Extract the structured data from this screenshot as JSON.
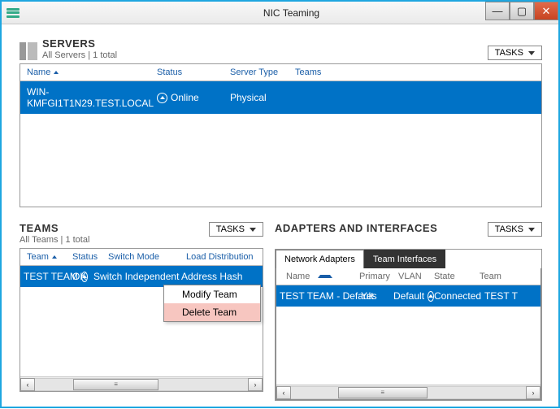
{
  "window": {
    "title": "NIC Teaming",
    "min": "—",
    "max": "▢",
    "close": "✕"
  },
  "servers": {
    "title": "SERVERS",
    "subtitle": "All Servers | 1 total",
    "tasks_label": "TASKS",
    "columns": {
      "name": "Name",
      "status": "Status",
      "type": "Server Type",
      "teams": "Teams"
    },
    "row": {
      "name": "WIN-KMFGI1T1N29.TEST.LOCAL",
      "status": "Online",
      "type": "Physical",
      "teams": ""
    }
  },
  "teams": {
    "title": "TEAMS",
    "subtitle": "All Teams | 1 total",
    "tasks_label": "TASKS",
    "columns": {
      "team": "Team",
      "status": "Status",
      "switch": "Switch Mode",
      "load": "Load Distribution"
    },
    "row": {
      "team": "TEST TEAM",
      "status": "OK",
      "switch": "Switch Independent",
      "load": "Address Hash"
    },
    "context_menu": {
      "modify": "Modify Team",
      "delete": "Delete Team"
    }
  },
  "adapters": {
    "title": "ADAPTERS AND INTERFACES",
    "tasks_label": "TASKS",
    "tabs": {
      "network": "Network Adapters",
      "team": "Team Interfaces"
    },
    "columns": {
      "name": "Name",
      "primary": "Primary",
      "vlan": "VLAN",
      "state": "State",
      "team": "Team"
    },
    "row": {
      "name": "TEST TEAM - Default",
      "primary": "Yes",
      "vlan": "Default",
      "state": "Connected",
      "team": "TEST T"
    }
  }
}
